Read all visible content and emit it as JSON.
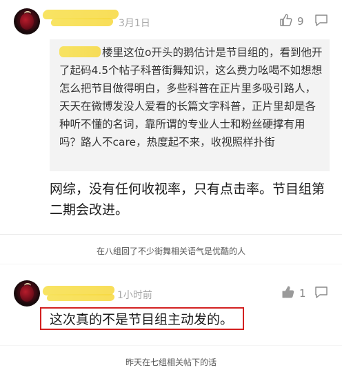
{
  "comment1": {
    "avatar_icon": "avatar-icon",
    "date": "3月1日",
    "like_count": "9",
    "like_icon": "thumbs-up-outline-icon",
    "reply_icon": "comment-bubble-icon",
    "quote_author_prefix": "@",
    "quote_text": "楼里这位o开头的鹅估计是节目组的，看到他开了起码4.5个帖子科普街舞知识，这么费力吆喝不如想想怎么把节目做得明白，多些科普在正片里多吸引路人，天天在微博发没人爱看的长篇文字科普，正片里却是各种听不懂的名词，靠所谓的专业人士和粉丝硬撑有用吗？路人不care，热度起不来，收视照样扑街",
    "reply_text": "网综，没有任何收视率，只有点击率。节目组第二期会改进。"
  },
  "caption1": "在八组回了不少街舞相关语气是优酷的人",
  "comment2": {
    "avatar_icon": "avatar-icon",
    "time": "1小时前",
    "like_count": "1",
    "like_icon": "thumbs-up-filled-icon",
    "reply_icon": "comment-bubble-icon",
    "text": "这次真的不是节目组主动发的。",
    "highlight_color": "#d32020"
  },
  "caption2": "昨天在七组相关帖下的话"
}
